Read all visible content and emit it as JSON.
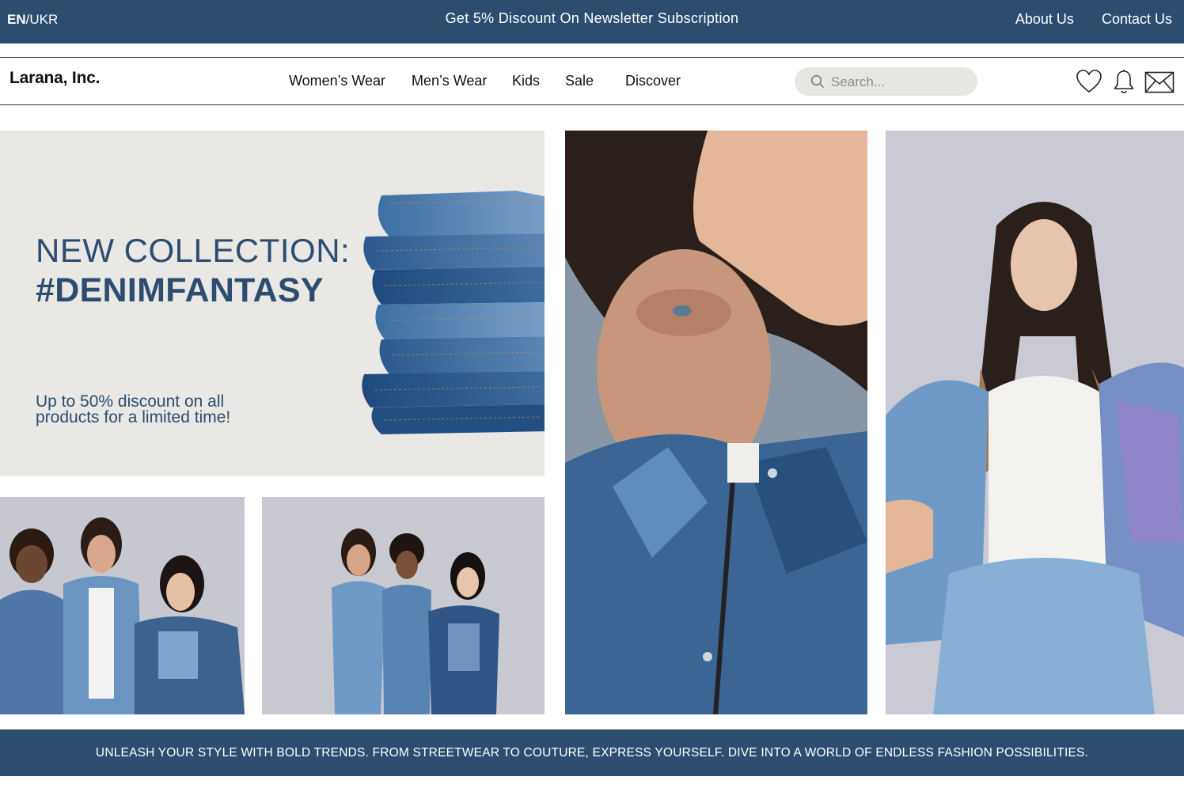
{
  "topbar": {
    "lang_active": "EN",
    "lang_separator": "/",
    "lang_other": "UKR",
    "promo": "Get 5% Discount On Newsletter Subscription",
    "links": [
      "About Us",
      "Contact Us"
    ]
  },
  "header": {
    "logo": "Larana, Inc.",
    "nav": [
      "Women’s Wear",
      "Men’s Wear",
      "Kids",
      "Sale",
      "Discover"
    ],
    "search_placeholder": "Search...",
    "icons": [
      "heart-icon",
      "bell-icon",
      "mail-icon"
    ]
  },
  "hero": {
    "title_line1": "NEW COLLECTION:",
    "title_line2": "#DENIMFANTASY",
    "subtitle": "Up to 50% discount on all products for a limited time!"
  },
  "banner": {
    "text": "UNLEASH YOUR STYLE WITH BOLD TRENDS. FROM STREETWEAR TO COUTURE, EXPRESS YOURSELF. DIVE INTO A WORLD OF ENDLESS FASHION POSSIBILITIES."
  },
  "colors": {
    "brand": "#2d4d70",
    "hero_bg": "#e9e8e4",
    "search_bg": "#e8e6e1",
    "photo_bg": "#c9cad3"
  }
}
